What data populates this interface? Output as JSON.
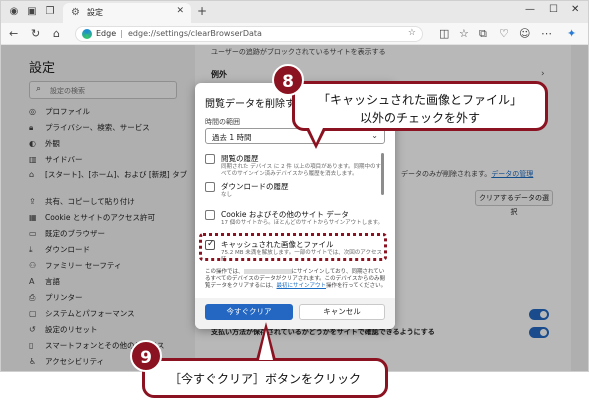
{
  "tab": {
    "title": "設定"
  },
  "address": {
    "prefix": "Edge",
    "url": "edge://settings/clearBrowserData"
  },
  "sidebar": {
    "title": "設定",
    "search_placeholder": "設定の検索",
    "items": [
      {
        "icon": "profile-icon",
        "label": "プロファイル"
      },
      {
        "icon": "lock-icon",
        "label": "プライバシー、検索、サービス"
      },
      {
        "icon": "palette-icon",
        "label": "外観"
      },
      {
        "icon": "sidebar-icon",
        "label": "サイドバー"
      },
      {
        "icon": "home-icon",
        "label": "[スタート]、[ホーム]、および [新規] タブ"
      },
      {
        "icon": "share-icon",
        "label": "共有、コピーして貼り付け"
      },
      {
        "icon": "cookie-icon",
        "label": "Cookie とサイトのアクセス許可"
      },
      {
        "icon": "browser-icon",
        "label": "既定のブラウザー"
      },
      {
        "icon": "download-icon",
        "label": "ダウンロード"
      },
      {
        "icon": "family-icon",
        "label": "ファミリー セーフティ"
      },
      {
        "icon": "language-icon",
        "label": "言語"
      },
      {
        "icon": "printer-icon",
        "label": "プリンター"
      },
      {
        "icon": "system-icon",
        "label": "システムとパフォーマンス"
      },
      {
        "icon": "reset-icon",
        "label": "設定のリセット"
      },
      {
        "icon": "phone-icon",
        "label": "スマートフォンとその他のデバイス"
      },
      {
        "icon": "accessibility-icon",
        "label": "アクセシビリティ"
      }
    ]
  },
  "content": {
    "top_text": "ユーザーの追跡がブロックされているサイトを表示する",
    "exceptions_heading": "例外",
    "right_text": "データのみが削除されます。",
    "data_manage_link": "データの管理",
    "choose_button": "クリアするデータの選択",
    "bottom_text": "支払い方法が保存されているかどうかをサイトで確認できるようにする"
  },
  "dialog": {
    "title": "閲覧データを削除する",
    "time_range_label": "時間の範囲",
    "time_range_value": "過去 1 時間",
    "items": [
      {
        "title": "閲覧の履歴",
        "desc": "同期された デバイス に 2 件 以上の項目があります。同期中のすべてのサインイン済みデバイスから履歴を消去します。",
        "checked": false
      },
      {
        "title": "ダウンロードの履歴",
        "desc": "なし",
        "checked": false
      },
      {
        "title": "Cookie およびその他のサイト データ",
        "desc": "17 個のサイトから。ほとんどのサイトからサインアウトします。",
        "checked": false
      },
      {
        "title": "キャッシュされた画像とファイル",
        "desc": "75.2 MB 未満を解放します。一部のサイトでは、次回のアクセス時",
        "checked": true
      }
    ],
    "note_1": "この操作では、",
    "note_2": "にサインインしており、同期されているすべてのデバイスのデータがクリアされます。このデバイスからのみ閲覧データをクリアするには、",
    "note_link": "最初にサインアウト",
    "note_3": "操作を行ってください。",
    "clear_button": "今すぐクリア",
    "cancel_button": "キャンセル"
  },
  "annotations": {
    "step8_number": "8",
    "step8_line1": "「キャッシュされた画像とファイル」",
    "step8_line2": "以外のチェックを外す",
    "step9_number": "9",
    "step9_text": "［今すぐクリア］ボタンをクリック"
  }
}
